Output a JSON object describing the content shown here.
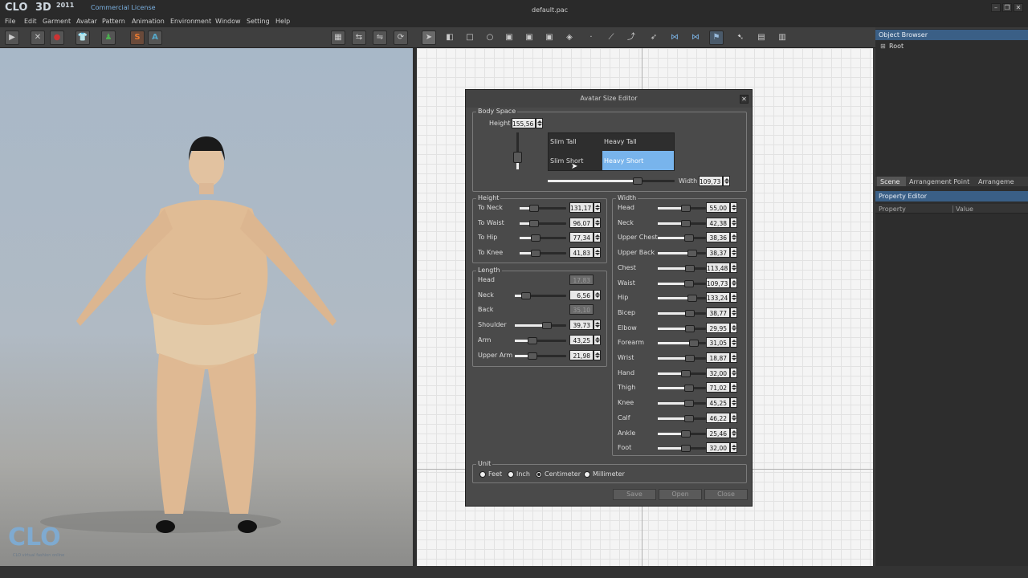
{
  "app": {
    "logo": "CLO",
    "version": "3D",
    "year": "2011",
    "license": "Commercial License",
    "file": "default.pac"
  },
  "menu": [
    "File",
    "Edit",
    "Garment",
    "Avatar",
    "Pattern",
    "Animation",
    "Environment",
    "Window",
    "Setting",
    "Help"
  ],
  "viewport": {
    "watermark": "CLO",
    "watermark_sub": "CLO virtual fashion online"
  },
  "right": {
    "object_browser": "Object Browser",
    "root": "Root",
    "tabs": [
      "Scene",
      "Arrangement Point",
      "Arrangeme"
    ],
    "property_editor": "Property Editor",
    "col_property": "Property",
    "col_value": "Value"
  },
  "dialog": {
    "title": "Avatar Size Editor",
    "body_space": {
      "label": "Body Space",
      "height_label": "Height",
      "height_value": "155,56",
      "width_label": "Width",
      "width_value": "109,73",
      "cells": [
        "Slim Tall",
        "Heavy Tall",
        "Slim Short",
        "Heavy Short"
      ]
    },
    "height_group": {
      "label": "Height",
      "items": [
        {
          "label": "To Neck",
          "value": "131,17",
          "pos": 0.25
        },
        {
          "label": "To Waist",
          "value": "96,07",
          "pos": 0.25
        },
        {
          "label": "To Hip",
          "value": "77,34",
          "pos": 0.3
        },
        {
          "label": "To Knee",
          "value": "41,83",
          "pos": 0.3
        }
      ]
    },
    "length_group": {
      "label": "Length",
      "items": [
        {
          "label": "Head",
          "value": "17,83",
          "pos": null,
          "disabled": true
        },
        {
          "label": "Neck",
          "value": "6,56",
          "pos": 0.15
        },
        {
          "label": "Back",
          "value": "35,10",
          "pos": null,
          "disabled": true
        },
        {
          "label": "Shoulder",
          "value": "39,73",
          "pos": 0.65
        },
        {
          "label": "Arm",
          "value": "43,25",
          "pos": 0.3
        },
        {
          "label": "Upper Arm",
          "value": "21,98",
          "pos": 0.3
        }
      ]
    },
    "width_group": {
      "label": "Width",
      "items": [
        {
          "label": "Head",
          "value": "55,00",
          "pos": 0.6
        },
        {
          "label": "Neck",
          "value": "42,38",
          "pos": 0.6
        },
        {
          "label": "Upper Chest",
          "value": "38,36",
          "pos": 0.68
        },
        {
          "label": "Upper Back",
          "value": "38,37",
          "pos": 0.78
        },
        {
          "label": "Chest",
          "value": "113,48",
          "pos": 0.7
        },
        {
          "label": "Waist",
          "value": "109,73",
          "pos": 0.68
        },
        {
          "label": "Hip",
          "value": "133,24",
          "pos": 0.78
        },
        {
          "label": "Bicep",
          "value": "38,77",
          "pos": 0.7
        },
        {
          "label": "Elbow",
          "value": "29,95",
          "pos": 0.7
        },
        {
          "label": "Forearm",
          "value": "31,05",
          "pos": 0.82
        },
        {
          "label": "Wrist",
          "value": "18,87",
          "pos": 0.7
        },
        {
          "label": "Hand",
          "value": "32,00",
          "pos": 0.6
        },
        {
          "label": "Thigh",
          "value": "71,02",
          "pos": 0.68
        },
        {
          "label": "Knee",
          "value": "45,25",
          "pos": 0.68
        },
        {
          "label": "Calf",
          "value": "46,22",
          "pos": 0.68
        },
        {
          "label": "Ankle",
          "value": "25,46",
          "pos": 0.6
        },
        {
          "label": "Foot",
          "value": "32,00",
          "pos": 0.6
        }
      ]
    },
    "unit": {
      "label": "Unit",
      "options": [
        "Feet",
        "Inch",
        "Centimeter",
        "Millimeter"
      ],
      "selected": "Centimeter"
    },
    "buttons": {
      "save": "Save",
      "open": "Open",
      "close": "Close"
    }
  },
  "colors": {
    "selected_cell": "#78b4ec",
    "panel_header": "#3a5f86"
  }
}
